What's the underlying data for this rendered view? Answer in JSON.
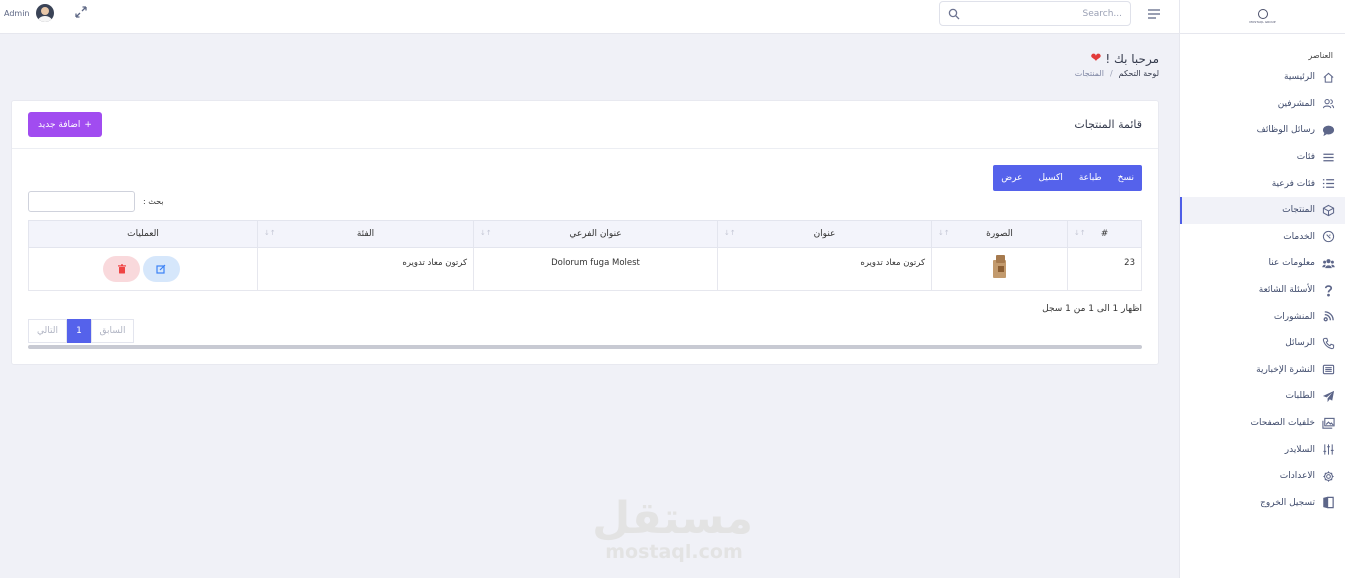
{
  "topbar": {
    "user_name": "Admin",
    "search_placeholder": "Search..."
  },
  "logo": {
    "text": "MOSTAQL GROUP"
  },
  "sidebar": {
    "heading": "العناصر",
    "items": [
      {
        "label": "الرئيسية",
        "icon": "home-icon"
      },
      {
        "label": "المشرفين",
        "icon": "users-icon"
      },
      {
        "label": "رسائل الوظائف",
        "icon": "chat-icon"
      },
      {
        "label": "فئات",
        "icon": "list-icon"
      },
      {
        "label": "فئات فرعية",
        "icon": "list-bullets-icon"
      },
      {
        "label": "المنتجات",
        "icon": "box-icon",
        "active": true
      },
      {
        "label": "الخدمات",
        "icon": "service-icon"
      },
      {
        "label": "معلومات عنا",
        "icon": "people-icon"
      },
      {
        "label": "الأسئلة الشائعة",
        "icon": "question-icon"
      },
      {
        "label": "المنشورات",
        "icon": "broadcast-icon"
      },
      {
        "label": "الرسائل",
        "icon": "phone-icon"
      },
      {
        "label": "النشرة الإخبارية",
        "icon": "newspaper-icon"
      },
      {
        "label": "الطلبات",
        "icon": "paper-plane-icon"
      },
      {
        "label": "خلفيات الصفحات",
        "icon": "images-icon"
      },
      {
        "label": "السلايدر",
        "icon": "sliders-icon"
      },
      {
        "label": "الاعدادات",
        "icon": "gear-icon"
      },
      {
        "label": "تسجيل الخروج",
        "icon": "logout-icon"
      }
    ]
  },
  "header": {
    "welcome": "مرحبا بك !",
    "breadcrumb_home": "لوحة التحكم",
    "breadcrumb_sep": "/",
    "breadcrumb_current": "المنتجات"
  },
  "card": {
    "title": "قائمة المنتجات",
    "add_button": "اضافة جديد",
    "export_buttons": [
      "نسخ",
      "طباعة",
      "اكسيل",
      "عرض"
    ],
    "search_label": "بحث :",
    "columns": [
      "#",
      "الصورة",
      "عنوان",
      "عنوان الفرعي",
      "الفئة",
      "العمليات"
    ],
    "rows": [
      {
        "id": "23",
        "title": "كرتون معاد تدويره",
        "subtitle": "Dolorum fuga Molest",
        "category": "كرتون معاد تدويره"
      }
    ],
    "info": "اظهار 1 الى 1 من 1 سجل",
    "pager": {
      "prev": "السابق",
      "page": "1",
      "next": "التالي"
    }
  },
  "watermark": {
    "arabic": "مستقل",
    "latin": "mostaql.com"
  },
  "colors": {
    "accent": "#5562eb",
    "add_button": "#a14cf0",
    "heart": "#e23b3b"
  }
}
